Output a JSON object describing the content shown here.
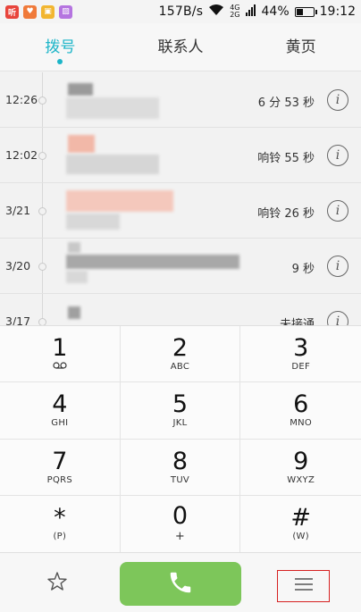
{
  "status_bar": {
    "app_icons": [
      {
        "name": "app-icon-1",
        "glyph": "听",
        "color": "#e8453c"
      },
      {
        "name": "app-icon-2",
        "glyph": "♥",
        "color": "#f07a3a"
      },
      {
        "name": "app-icon-3",
        "glyph": "▣",
        "color": "#f2b630"
      },
      {
        "name": "app-icon-4",
        "glyph": "▨",
        "color": "#b574e0"
      }
    ],
    "net_speed": "157B/s",
    "signal_top": "4G",
    "signal_bottom": "2G",
    "battery_text": "44%",
    "battery_level": 0.44,
    "time": "19:12"
  },
  "tabs": [
    {
      "label": "拨号",
      "active": true
    },
    {
      "label": "联系人",
      "active": false
    },
    {
      "label": "黄页",
      "active": false
    }
  ],
  "call_log": [
    {
      "time": "12:26",
      "detail": "6 分 53 秒"
    },
    {
      "time": "12:02",
      "detail": "响铃 55 秒"
    },
    {
      "time": "3/21",
      "detail": "响铃 26 秒"
    },
    {
      "time": "3/20",
      "detail": "9 秒"
    },
    {
      "time": "3/17",
      "detail": "未接通"
    }
  ],
  "dialpad": [
    {
      "digit": "1",
      "letters": "ᴏᴏ"
    },
    {
      "digit": "2",
      "letters": "ABC"
    },
    {
      "digit": "3",
      "letters": "DEF"
    },
    {
      "digit": "4",
      "letters": "GHI"
    },
    {
      "digit": "5",
      "letters": "JKL"
    },
    {
      "digit": "6",
      "letters": "MNO"
    },
    {
      "digit": "7",
      "letters": "PQRS"
    },
    {
      "digit": "8",
      "letters": "TUV"
    },
    {
      "digit": "9",
      "letters": "WXYZ"
    },
    {
      "digit": "*",
      "letters": "(P)"
    },
    {
      "digit": "0",
      "letters": "+"
    },
    {
      "digit": "#",
      "letters": "(W)"
    }
  ],
  "bottom_bar": {
    "favorites_icon": "star-icon",
    "call_icon": "phone-icon",
    "menu_icon": "menu-icon",
    "call_color": "#7dc65a",
    "highlight_color": "#d62020"
  },
  "colors": {
    "accent": "#1cb5c8"
  }
}
